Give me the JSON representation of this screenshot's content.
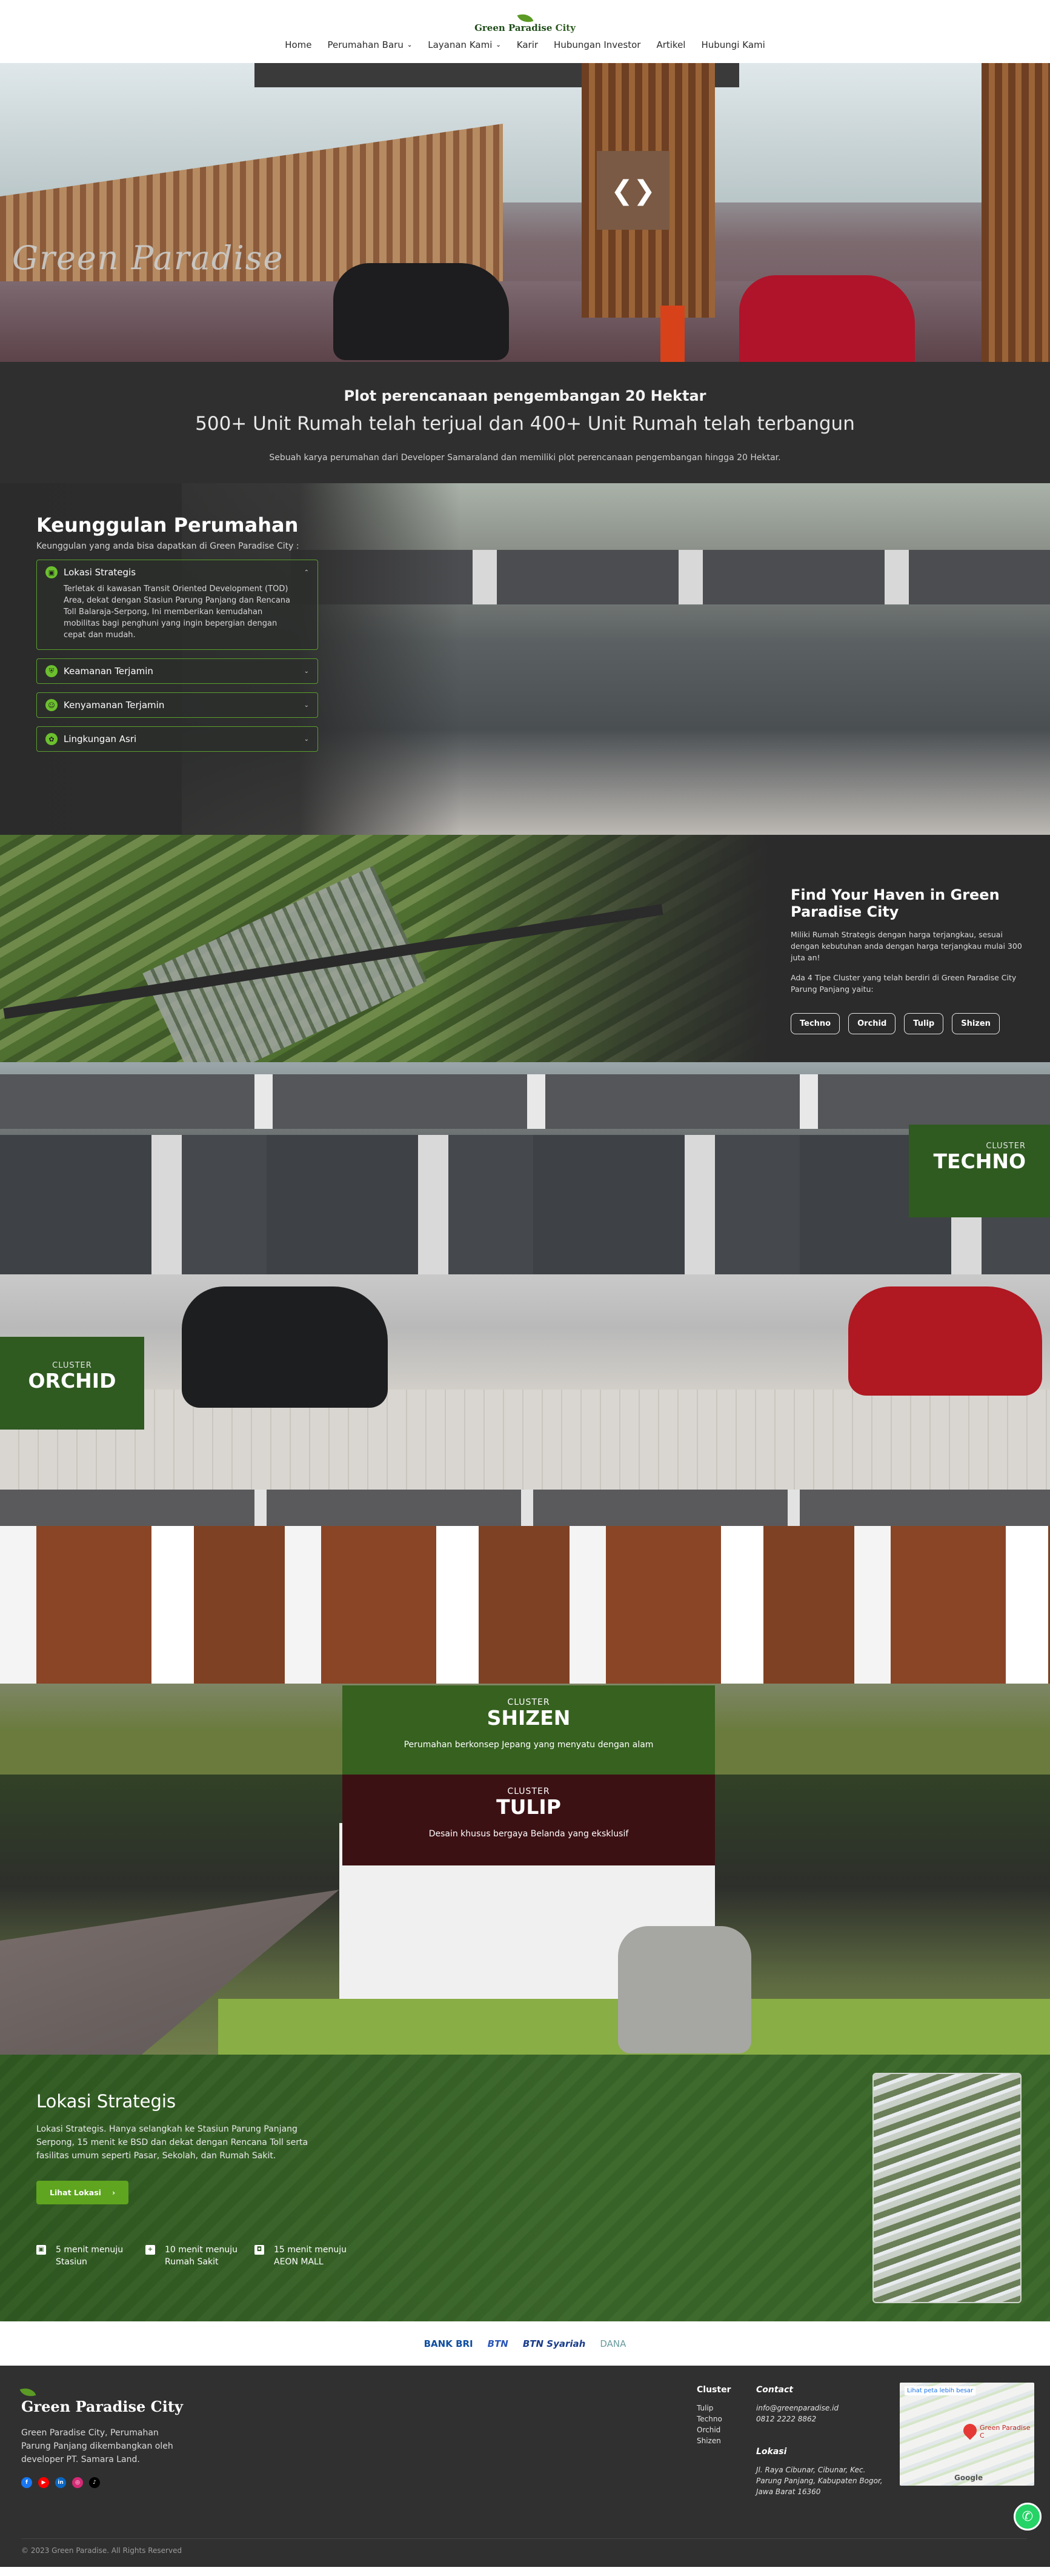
{
  "header": {
    "logo_text": "Green Paradise",
    "logo_text2": "City",
    "nav": [
      {
        "label": "Home"
      },
      {
        "label": "Perumahan Baru",
        "has_dropdown": true
      },
      {
        "label": "Layanan Kami",
        "has_dropdown": true
      },
      {
        "label": "Karir"
      },
      {
        "label": "Hubungan Investor"
      },
      {
        "label": "Artikel"
      },
      {
        "label": "Hubungi Kami"
      }
    ]
  },
  "hero": {
    "sign_text": "Green Paradise"
  },
  "plot": {
    "kicker": "Plot perencanaan pengembangan 20 Hektar",
    "headline": "500+ Unit Rumah telah terjual dan 400+ Unit Rumah telah terbangun",
    "desc": "Sebuah karya perumahan dari Developer Samaraland dan memiliki plot perencanaan pengembangan hingga 20 Hektar."
  },
  "keunggulan": {
    "title": "Keunggulan Perumahan",
    "subtitle": "Keunggulan yang anda bisa dapatkan di Green Paradise City :",
    "items": [
      {
        "label": "Lokasi Strategis",
        "icon": "train-icon",
        "expanded": true,
        "body": "Terletak di kawasan Transit Oriented Development (TOD) Area, dekat dengan Stasiun Parung Panjang dan Rencana Toll Balaraja-Serpong, Ini memberikan kemudahan mobilitas bagi penghuni yang ingin bepergian dengan cepat dan mudah."
      },
      {
        "label": "Keamanan Terjamin",
        "icon": "shield-icon",
        "expanded": false
      },
      {
        "label": "Kenyamanan Terjamin",
        "icon": "smile-icon",
        "expanded": false
      },
      {
        "label": "Lingkungan Asri",
        "icon": "leaf-icon",
        "expanded": false
      }
    ]
  },
  "haven": {
    "title": "Find Your Haven in Green Paradise City",
    "p1": "Miliki Rumah Strategis dengan harga terjangkau, sesuai dengan kebutuhan anda dengan harga terjangkau mulai 300 juta an!",
    "p2": "Ada 4 Tipe Cluster yang telah berdiri di Green Paradise City Parung Panjang yaitu:",
    "clusters": [
      "Techno",
      "Orchid",
      "Tulip",
      "Shizen"
    ]
  },
  "clusters": {
    "techno": {
      "kicker": "CLUSTER",
      "name": "TECHNO"
    },
    "orchid": {
      "kicker": "CLUSTER",
      "name": "ORCHID"
    },
    "shizen": {
      "kicker": "CLUSTER",
      "name": "SHIZEN",
      "desc": "Perumahan berkonsep Jepang yang menyatu dengan alam"
    },
    "tulip": {
      "kicker": "CLUSTER",
      "name": "TULIP",
      "desc": "Desain khusus bergaya Belanda yang eksklusif"
    }
  },
  "lokasi": {
    "title": "Lokasi Strategis",
    "desc": "Lokasi Strategis. Hanya selangkah ke Stasiun Parung Panjang Serpong, 15 menit ke BSD dan dekat dengan Rencana Toll serta fasilitas umum seperti Pasar, Sekolah, dan Rumah Sakit.",
    "button": "Lihat Lokasi",
    "distances": [
      {
        "icon": "train-icon",
        "line1": "5 menit menuju",
        "line2": "Stasiun"
      },
      {
        "icon": "hospital-icon",
        "line1": "10 menit menuju",
        "line2": "Rumah Sakit"
      },
      {
        "icon": "mall-icon",
        "line1": "15 menit menuju",
        "line2": "AEON MALL"
      }
    ]
  },
  "partners": [
    "BANK BRI",
    "BTN",
    "BTN Syariah",
    "DANA"
  ],
  "footer": {
    "brand": "Green Paradise",
    "brand2": "City",
    "about": "Green Paradise City, Perumahan Parung Panjang dikembangkan oleh developer PT. Samara Land.",
    "cluster_title": "Cluster",
    "cluster_items": [
      "Tulip",
      "Techno",
      "Orchid",
      "Shizen"
    ],
    "contact_title": "Contact",
    "email": "info@greenparadise.id",
    "phone": "0812 2222 8862",
    "lokasi_title": "Lokasi",
    "address": "Jl. Raya Cibunar, Cibunar, Kec. Parung Panjang, Kabupaten Bogor, Jawa Barat 16360",
    "map_link": "Lihat peta lebih besar",
    "map_place": "Green Paradise C",
    "map_brand": "Google",
    "copyright": "© 2023 Green Paradise. All Rights Reserved"
  }
}
